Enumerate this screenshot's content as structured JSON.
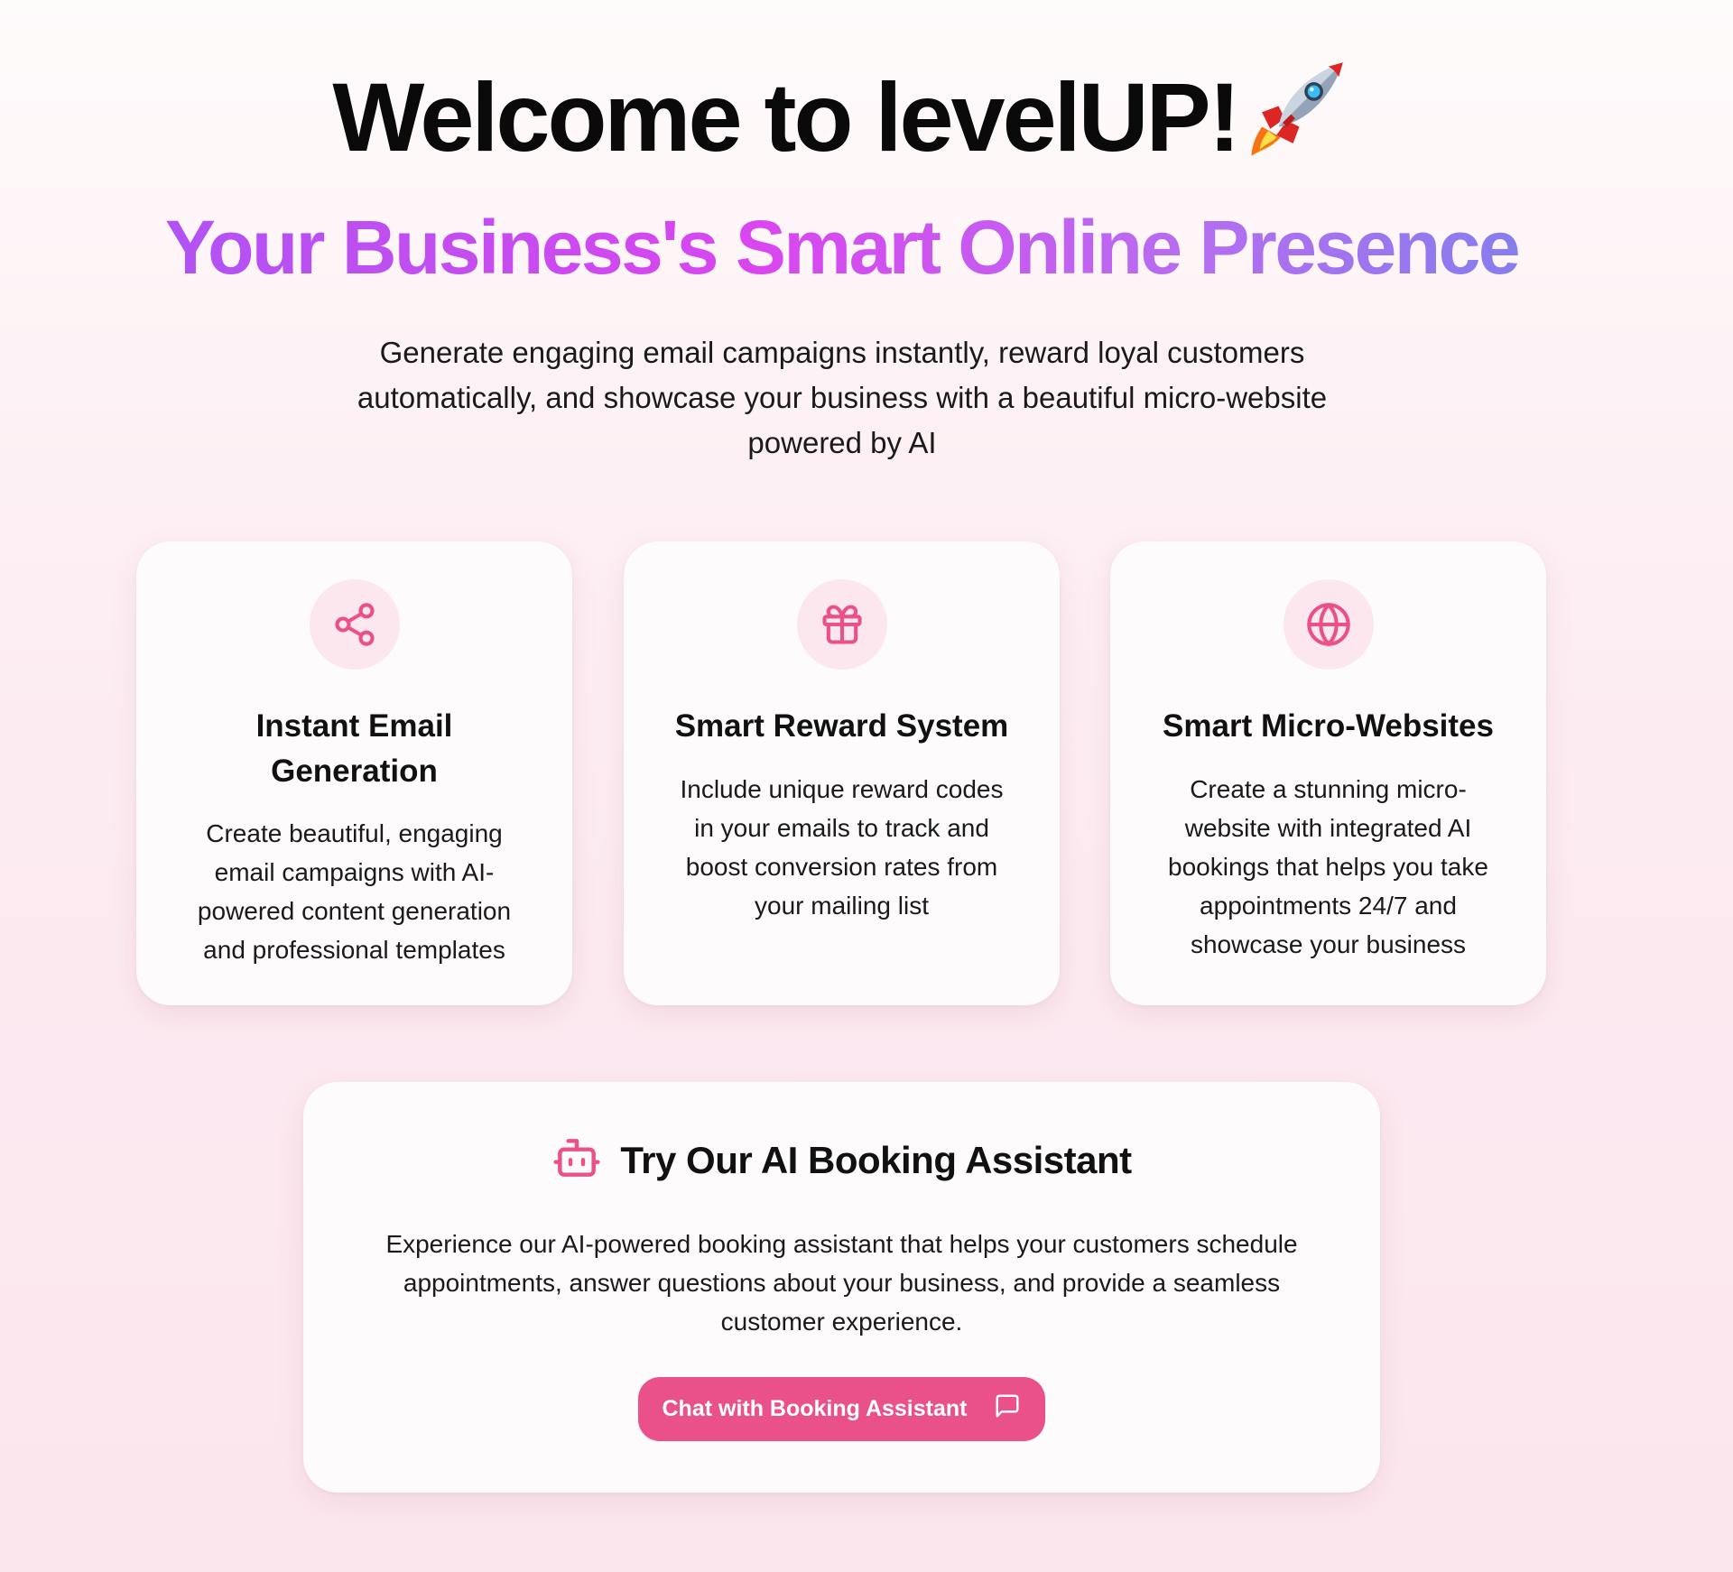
{
  "hero": {
    "title": "Welcome to levelUP!",
    "title_emoji": "rocket-icon",
    "subtitle": "Your Business's Smart Online Presence",
    "description": "Generate engaging email campaigns instantly, reward loyal customers automatically, and showcase your business with a beautiful micro-website powered by AI"
  },
  "features": [
    {
      "icon": "share-icon",
      "title": "Instant Email Generation",
      "text": "Create beautiful, engaging email campaigns with AI-powered content generation and professional templates"
    },
    {
      "icon": "gift-icon",
      "title": "Smart Reward System",
      "text": "Include unique reward codes in your emails to track and boost conversion rates from your mailing list"
    },
    {
      "icon": "globe-icon",
      "title": "Smart Micro-Websites",
      "text": "Create a stunning micro-website with integrated AI bookings that helps you take appointments 24/7 and showcase your business"
    }
  ],
  "assistant": {
    "icon": "bot-icon",
    "title": "Try Our AI Booking Assistant",
    "text": "Experience our AI-powered booking assistant that helps your customers schedule appointments, answer questions about your business, and provide a seamless customer experience.",
    "button_label": "Chat with Booking Assistant",
    "button_icon": "message-square-icon"
  },
  "colors": {
    "accent": "#ea5089",
    "icon_bg": "#fce7ef",
    "gradient_start": "#a855f7",
    "gradient_mid": "#d946ef",
    "gradient_end": "#6f86ec"
  }
}
